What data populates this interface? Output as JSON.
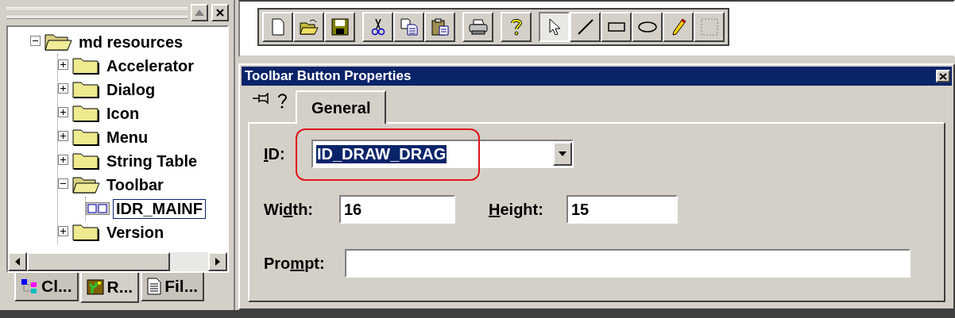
{
  "workspace": {
    "tree": {
      "label": "md resources",
      "expanded": true,
      "children": [
        {
          "label": "Accelerator",
          "expanded": false,
          "selected": false
        },
        {
          "label": "Dialog",
          "expanded": false,
          "selected": false
        },
        {
          "label": "Icon",
          "expanded": false,
          "selected": false
        },
        {
          "label": "Menu",
          "expanded": false,
          "selected": false
        },
        {
          "label": "String Table",
          "expanded": false,
          "selected": false
        },
        {
          "label": "Toolbar",
          "expanded": true,
          "selected": false,
          "children": [
            {
              "label": "IDR_MAINF",
              "kind": "toolbar",
              "selected": true
            }
          ]
        },
        {
          "label": "Version",
          "expanded": false,
          "selected": false
        }
      ]
    },
    "tabs": [
      {
        "label": "Cl...",
        "kind": "classes",
        "selected": false
      },
      {
        "label": "R...",
        "kind": "resources",
        "selected": true
      },
      {
        "label": "Fil...",
        "kind": "files",
        "selected": false
      }
    ]
  },
  "toolbar": {
    "groups": [
      [
        {
          "kind": "new",
          "selected": false
        },
        {
          "kind": "open",
          "selected": false
        },
        {
          "kind": "save",
          "selected": false
        }
      ],
      [
        {
          "kind": "cut",
          "selected": false
        },
        {
          "kind": "copy",
          "selected": false
        },
        {
          "kind": "paste",
          "selected": false
        }
      ],
      [
        {
          "kind": "print",
          "selected": false
        }
      ],
      [
        {
          "kind": "help",
          "selected": false
        }
      ],
      [
        {
          "kind": "pointer",
          "selected": true
        },
        {
          "kind": "line",
          "selected": false
        },
        {
          "kind": "rectangle",
          "selected": false
        },
        {
          "kind": "ellipse",
          "selected": false
        },
        {
          "kind": "pencil",
          "selected": false
        },
        {
          "kind": "select",
          "selected": false
        }
      ]
    ]
  },
  "dialog": {
    "title": "Toolbar Button Properties",
    "tabs": [
      {
        "label": "General",
        "selected": true
      }
    ],
    "id_field": {
      "label": {
        "key": "I",
        "after": "D:"
      },
      "value": "ID_DRAW_DRAG",
      "text_selected": true,
      "circled": true
    },
    "width_field": {
      "label": {
        "before": "Wi",
        "key": "d",
        "after": "th:"
      },
      "value": "16"
    },
    "height_field": {
      "label": {
        "key": "H",
        "after": "eight:"
      },
      "value": "15"
    },
    "prompt_field": {
      "label": {
        "before": "Pro",
        "key": "m",
        "after": "pt:"
      }
    }
  }
}
